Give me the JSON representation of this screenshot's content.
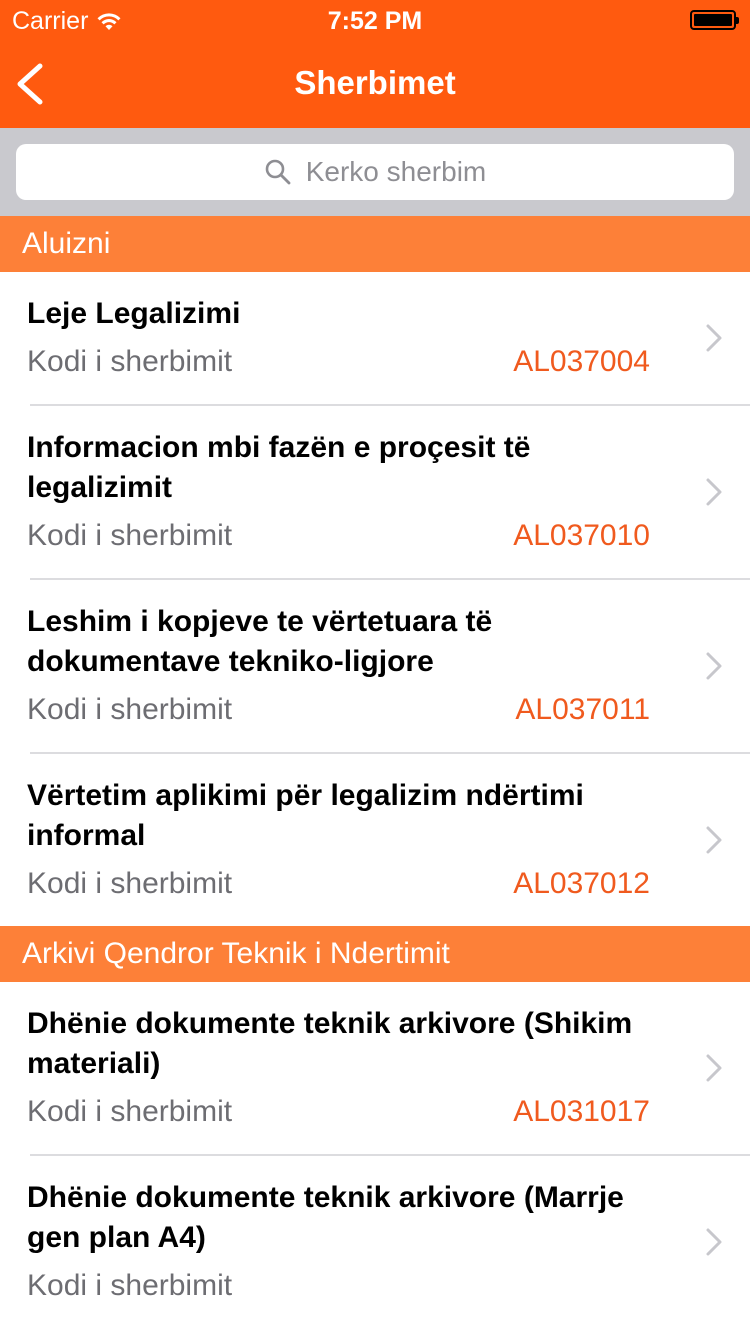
{
  "status_bar": {
    "carrier": "Carrier",
    "time": "7:52 PM"
  },
  "nav": {
    "title": "Sherbimet"
  },
  "search": {
    "placeholder": "Kerko sherbim"
  },
  "colors": {
    "header": "#ff5a0f",
    "section": "#fd8038",
    "code": "#f05a1e"
  },
  "sections": [
    {
      "title": "Aluizni",
      "items": [
        {
          "title": "Leje Legalizimi",
          "code_label": "Kodi i sherbimit",
          "code": "AL037004"
        },
        {
          "title": "Informacion mbi fazën e proçesit të legalizimit",
          "code_label": "Kodi i sherbimit",
          "code": "AL037010"
        },
        {
          "title": "Leshim i kopjeve te vërtetuara të dokumentave tekniko-ligjore",
          "code_label": "Kodi i sherbimit",
          "code": "AL037011"
        },
        {
          "title": "Vërtetim aplikimi për legalizim ndërtimi informal",
          "code_label": "Kodi i sherbimit",
          "code": "AL037012"
        }
      ]
    },
    {
      "title": "Arkivi Qendror Teknik i Ndertimit",
      "items": [
        {
          "title": "Dhënie dokumente teknik arkivore (Shikim materiali)",
          "code_label": "Kodi i sherbimit",
          "code": "AL031017"
        },
        {
          "title": "Dhënie dokumente teknik arkivore (Marrje gen plan A4)",
          "code_label": "Kodi i sherbimit",
          "code": ""
        }
      ]
    }
  ]
}
